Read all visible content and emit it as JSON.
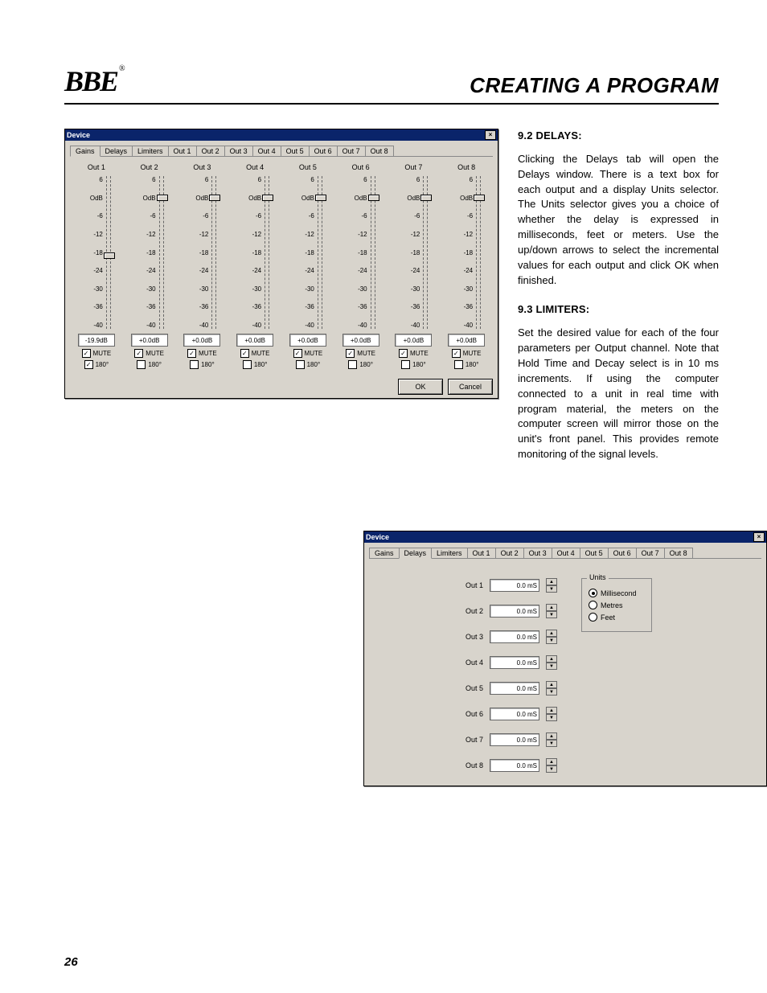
{
  "header": {
    "logo_text": "BBE",
    "logo_reg": "®",
    "title": "CREATING A PROGRAM"
  },
  "text": {
    "h_delays": "9.2 DELAYS:",
    "p_delays": "Clicking the Delays tab will open the Delays window. There is a text box for each output and a display Units selector. The Units selector gives you a choice of whether the delay is expressed in milliseconds, feet or meters. Use the up/down arrows to select the incremental values for each output and click OK when finished.",
    "h_limiters": "9.3 LIMITERS:",
    "p_limiters": "Set the desired value for each of the four parameters per Output channel. Note that Hold Time and Decay select is in 10 ms increments. If using the computer connected to a unit in real time with program material, the meters on the computer screen will mirror those on the unit's front panel. This provides remote monitoring of the signal levels."
  },
  "dlg_common": {
    "title": "Device",
    "ok": "OK",
    "cancel": "Cancel"
  },
  "tabs": [
    "Gains",
    "Delays",
    "Limiters",
    "Out 1",
    "Out 2",
    "Out 3",
    "Out 4",
    "Out 5",
    "Out 6",
    "Out 7",
    "Out 8"
  ],
  "gains": {
    "tick_labels": [
      "6",
      "OdB",
      "-6",
      "-12",
      "-18",
      "-24",
      "-30",
      "-36",
      "-40"
    ],
    "mute_label": "MUTE",
    "phase_label": "180°",
    "channels": [
      {
        "label": "Out 1",
        "value": "-19.9dB",
        "mute": true,
        "phase": true,
        "thumb": 0.5
      },
      {
        "label": "Out 2",
        "value": "+0.0dB",
        "mute": true,
        "phase": false,
        "thumb": 0.12
      },
      {
        "label": "Out 3",
        "value": "+0.0dB",
        "mute": true,
        "phase": false,
        "thumb": 0.12
      },
      {
        "label": "Out 4",
        "value": "+0.0dB",
        "mute": true,
        "phase": false,
        "thumb": 0.12
      },
      {
        "label": "Out 5",
        "value": "+0.0dB",
        "mute": true,
        "phase": false,
        "thumb": 0.12
      },
      {
        "label": "Out 6",
        "value": "+0.0dB",
        "mute": true,
        "phase": false,
        "thumb": 0.12
      },
      {
        "label": "Out 7",
        "value": "+0.0dB",
        "mute": true,
        "phase": false,
        "thumb": 0.12
      },
      {
        "label": "Out 8",
        "value": "+0.0dB",
        "mute": true,
        "phase": false,
        "thumb": 0.12
      }
    ]
  },
  "delays": {
    "rows": [
      {
        "label": "Out 1",
        "value": "0.0 mS"
      },
      {
        "label": "Out 2",
        "value": "0.0 mS"
      },
      {
        "label": "Out 3",
        "value": "0.0 mS"
      },
      {
        "label": "Out 4",
        "value": "0.0 mS"
      },
      {
        "label": "Out 5",
        "value": "0.0 mS"
      },
      {
        "label": "Out 6",
        "value": "0.0 mS"
      },
      {
        "label": "Out 7",
        "value": "0.0 mS"
      },
      {
        "label": "Out 8",
        "value": "0.0 mS"
      }
    ],
    "units_title": "Units",
    "units": [
      {
        "label": "Millisecond",
        "selected": true
      },
      {
        "label": "Metres",
        "selected": false
      },
      {
        "label": "Feet",
        "selected": false
      }
    ]
  },
  "page_number": "26"
}
